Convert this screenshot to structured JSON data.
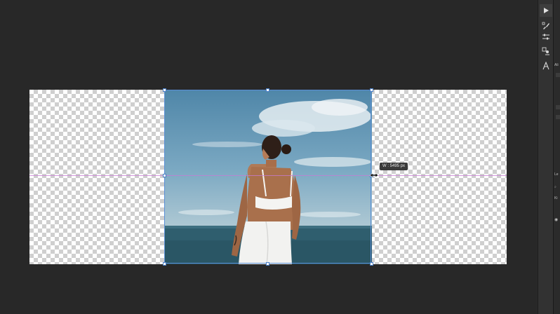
{
  "workspace": {
    "transform_tooltip": "W : 5495 px"
  },
  "toolstrip": {
    "tools": [
      {
        "name": "play-icon",
        "glyph": "▶"
      },
      {
        "name": "brush-settings-icon"
      },
      {
        "name": "adjustments-icon"
      },
      {
        "name": "clone-source-icon"
      },
      {
        "name": "character-icon",
        "glyph": "A"
      }
    ]
  },
  "panel_strip": {
    "properties_label": "Ali",
    "layers_label": "Le",
    "kind_label": "Ki"
  }
}
